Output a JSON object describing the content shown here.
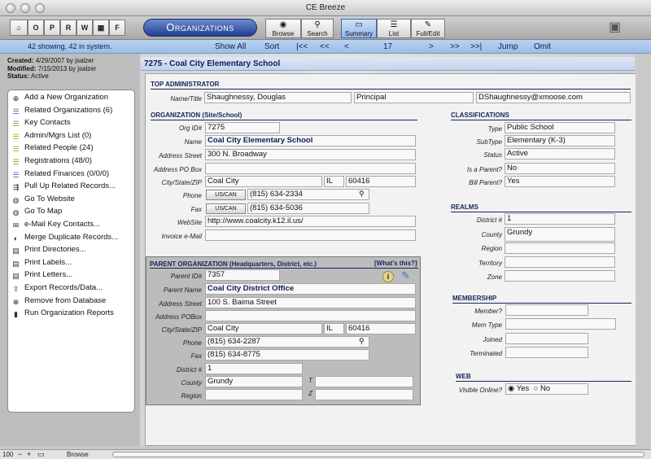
{
  "window": {
    "title": "CE Breeze"
  },
  "toolbar": {
    "letters": [
      "O",
      "P",
      "R",
      "W",
      "F"
    ],
    "org_button": "Organizations",
    "browse": "Browse",
    "search": "Search",
    "summary": "Summary",
    "list": "List",
    "full_edit": "Full/Edit"
  },
  "nav": {
    "count": "42 showing, 42 in system.",
    "show_all": "Show All",
    "sort": "Sort",
    "first": "|<<",
    "back_fast": "<<",
    "back": "<",
    "record": "17",
    "next": ">",
    "next_fast": ">>",
    "last": ">>|",
    "jump": "Jump",
    "omit": "Omit"
  },
  "meta": {
    "created_label": "Created:",
    "created": "4/29/2007 by jsalzer",
    "modified_label": "Modified:",
    "modified": "7/15/2013 by jsalzer",
    "status_label": "Status:",
    "status": "Active"
  },
  "actions": [
    {
      "label": "Add a New Organization",
      "icon": "plus-circle-icon"
    },
    {
      "label": "Related Organizations (6)",
      "icon": "list-icon"
    },
    {
      "label": "Key Contacts",
      "icon": "list-icon"
    },
    {
      "label": "Admin/Mgrs List (0)",
      "icon": "list-icon"
    },
    {
      "label": "Related People (24)",
      "icon": "list-icon"
    },
    {
      "label": "Registrations (48/0)",
      "icon": "list-icon"
    },
    {
      "label": "Related Finances (0/0/0)",
      "icon": "list-icon"
    },
    {
      "label": "Pull Up Related Records...",
      "icon": "tree-icon"
    },
    {
      "label": "Go To Website",
      "icon": "globe-icon"
    },
    {
      "label": "Go To Map",
      "icon": "globe-icon"
    },
    {
      "label": "e-Mail Key Contacts...",
      "icon": "envelope-icon"
    },
    {
      "label": "Merge Duplicate Records...",
      "icon": "merge-icon"
    },
    {
      "label": "Print Directories...",
      "icon": "printer-icon"
    },
    {
      "label": "Print Labels...",
      "icon": "printer-icon"
    },
    {
      "label": "Print Letters...",
      "icon": "printer-icon"
    },
    {
      "label": "Export Records/Data...",
      "icon": "export-icon"
    },
    {
      "label": "Remove from Database",
      "icon": "remove-icon"
    },
    {
      "label": "Run Organization Reports",
      "icon": "report-icon"
    }
  ],
  "record": {
    "title": "7275 - Coal City Elementary School"
  },
  "top_admin": {
    "header": "TOP ADMINISTRATOR",
    "label": "Name/Title",
    "name": "Shaughnessy, Douglas",
    "title": "Principal",
    "email": "DShaughnessy@xmoose.com"
  },
  "organization": {
    "header": "ORGANIZATION (Site/School)",
    "labels": {
      "org_id": "Org ID#",
      "name": "Name",
      "street": "Address Street",
      "pobox": "Address PO Box",
      "csz": "City/State/ZIP",
      "phone": "Phone",
      "fax": "Fax",
      "website": "WebSite",
      "invoice": "Invoice e-Mail"
    },
    "org_id": "7275",
    "name": "Coal City Elementary School",
    "street": "300 N. Broadway",
    "pobox": "",
    "city": "Coal City",
    "state": "IL",
    "zip": "60416",
    "phone_fmt": "US/CAN",
    "phone": "(815) 634-2334",
    "fax_fmt": "US/CAN",
    "fax": "(815) 634-5036",
    "website": "http://www.coalcity.k12.il.us/",
    "invoice_email": ""
  },
  "parent": {
    "header": "PARENT ORGANIZATION (Headquarters, District, etc.)",
    "whats_this": "[What's this?]",
    "labels": {
      "parent_id": "Parent ID#",
      "name": "Parent Name",
      "street": "Address Street",
      "pobox": "Address POBox",
      "csz": "City/State/ZIP",
      "phone": "Phone",
      "fax": "Fax",
      "district": "District #",
      "county": "County",
      "region": "Region",
      "t": "T",
      "z": "Z"
    },
    "parent_id": "7357",
    "name": "Coal City District Office",
    "street": "100 S. Baima Street",
    "pobox": "",
    "city": "Coal City",
    "state": "IL",
    "zip": "60416",
    "phone": "(815) 634-2287",
    "fax": "(815) 634-8775",
    "district": "1",
    "county": "Grundy",
    "region": "",
    "t_value": "",
    "z_value": ""
  },
  "classifications": {
    "header": "CLASSIFICATIONS",
    "labels": {
      "type": "Type",
      "subtype": "SubType",
      "status": "Status",
      "is_parent": "Is a Parent?",
      "bill_parent": "Bill Parent?"
    },
    "type": "Public School",
    "subtype": "Elementary (K-3)",
    "status": "Active",
    "is_parent": "No",
    "bill_parent": "Yes"
  },
  "realms": {
    "header": "REALMS",
    "labels": {
      "district": "District #",
      "county": "County",
      "region": "Region",
      "territory": "Territory",
      "zone": "Zone"
    },
    "district": "1",
    "county": "Grundy",
    "region": "",
    "territory": "",
    "zone": ""
  },
  "membership": {
    "header": "MEMBERSHIP",
    "labels": {
      "member": "Member?",
      "mem_type": "Mem Type",
      "joined": "Joined",
      "terminated": "Terminated"
    },
    "member": "",
    "mem_type": "",
    "joined": "",
    "terminated": ""
  },
  "web": {
    "header": "WEB",
    "label": "Visible Online?",
    "yes": "Yes",
    "no": "No",
    "selected": "Yes"
  },
  "statusbar": {
    "zoom": "100",
    "mode": "Browse"
  }
}
